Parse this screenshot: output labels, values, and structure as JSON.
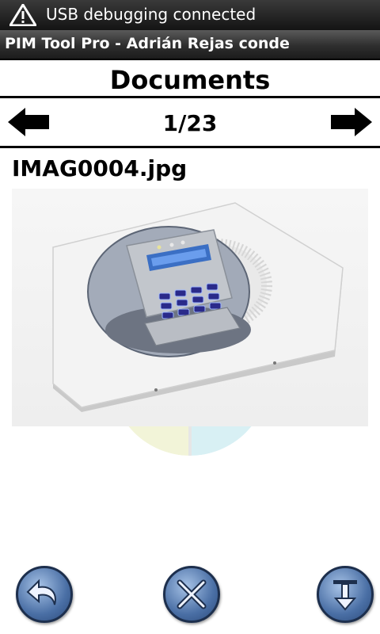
{
  "status_bar": {
    "notification": "USB debugging connected",
    "icon": "usb-warning-icon"
  },
  "app": {
    "title": "PIM Tool Pro - Adrián Rejas conde"
  },
  "page": {
    "heading": "Documents"
  },
  "pager": {
    "current": "1/23",
    "prev_icon": "arrow-left-icon",
    "next_icon": "arrow-right-icon"
  },
  "document": {
    "filename": "IMAG0004.jpg",
    "preview_icon": "alarm-keypad-photo"
  },
  "actions": [
    {
      "icon": "undo-icon"
    },
    {
      "icon": "cancel-tools-icon"
    },
    {
      "icon": "download-icon"
    }
  ],
  "colors": {
    "status_bar_bg": "#1a1a1a",
    "title_bar_bg": "#333333",
    "button_blue": "#4a6fa5"
  }
}
